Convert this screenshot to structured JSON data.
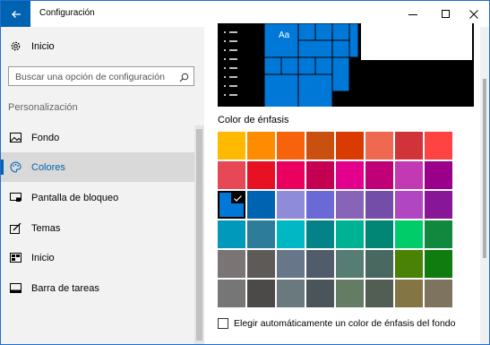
{
  "window": {
    "title": "Configuración",
    "controls": {
      "minimize": "minimize-icon",
      "maximize": "maximize-icon",
      "close": "close-icon"
    }
  },
  "sidebar": {
    "home_label": "Inicio",
    "search": {
      "placeholder": "Buscar una opción de configuración"
    },
    "section_title": "Personalización",
    "items": [
      {
        "label": "Fondo",
        "icon": "picture-icon",
        "active": false
      },
      {
        "label": "Colores",
        "icon": "palette-icon",
        "active": true
      },
      {
        "label": "Pantalla de bloqueo",
        "icon": "lock-screen-icon",
        "active": false
      },
      {
        "label": "Temas",
        "icon": "themes-icon",
        "active": false
      },
      {
        "label": "Inicio",
        "icon": "start-icon",
        "active": false
      },
      {
        "label": "Barra de tareas",
        "icon": "taskbar-icon",
        "active": false
      }
    ]
  },
  "main": {
    "preview_tile_label": "Aa",
    "accent_section_title": "Color de énfasis",
    "selected_color": "#0078d7",
    "swatches": [
      [
        "#ffb900",
        "#ff8c00",
        "#f7630c",
        "#ca5010",
        "#da3b01",
        "#ef6950",
        "#d13438",
        "#ff4343"
      ],
      [
        "#e74856",
        "#e81123",
        "#ea005e",
        "#c30052",
        "#e3008c",
        "#bf0077",
        "#c239b3",
        "#9a0089"
      ],
      [
        "#0078d7",
        "#0063b1",
        "#8e8cd8",
        "#6b69d6",
        "#8764b8",
        "#744da9",
        "#b146c2",
        "#881798"
      ],
      [
        "#0099bc",
        "#2d7d9a",
        "#00b7c3",
        "#038387",
        "#00b294",
        "#018574",
        "#00cc6a",
        "#10893e"
      ],
      [
        "#7a7574",
        "#5d5a58",
        "#68768a",
        "#515c6b",
        "#567c73",
        "#486860",
        "#498205",
        "#107c10"
      ],
      [
        "#767676",
        "#4c4a48",
        "#69797e",
        "#4a5459",
        "#647c64",
        "#525e54",
        "#847545",
        "#7e735f"
      ]
    ],
    "auto_accent_label": "Elegir automáticamente un color de énfasis del fondo",
    "auto_accent_checked": false
  },
  "colors": {
    "accent": "#0063b1",
    "sidebar_bg": "#f2f2f2",
    "preview_bg": "#000000",
    "tile_blue": "#0078d7"
  }
}
